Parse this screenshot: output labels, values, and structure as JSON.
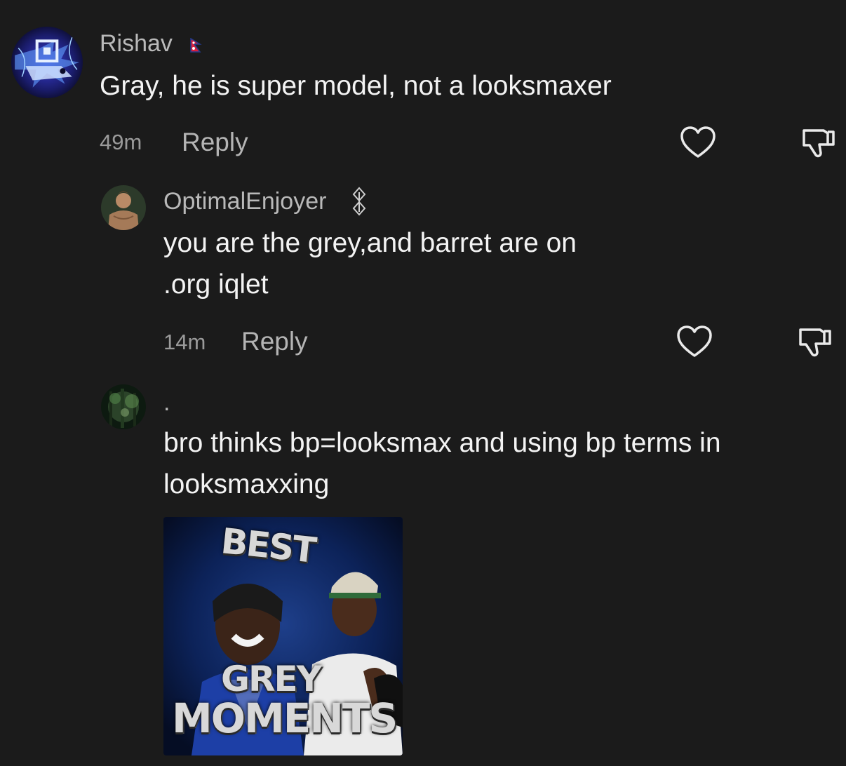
{
  "comments": [
    {
      "username": "Rishav",
      "badge_icon": "nepal-flag-icon",
      "text_lines": [
        "Gray, he is super model, not a looksmaxer"
      ],
      "time": "49m",
      "reply_label": "Reply",
      "avatar_icon": "geometry-dash-avatar"
    },
    {
      "username": "OptimalEnjoyer",
      "badge_icon": "chain-link-icon",
      "text_lines": [
        "you are the grey,and barret are on",
        ".org iqlet"
      ],
      "time": "14m",
      "reply_label": "Reply",
      "avatar_icon": "statue-avatar"
    },
    {
      "username": ".",
      "text_lines": [
        "bro thinks bp=looksmax and using bp terms in",
        "looksmaxxing"
      ],
      "avatar_icon": "forest-avatar",
      "attachment": {
        "line1": "BEST",
        "line2": "GREY",
        "line3": "MOMENTS"
      }
    }
  ],
  "icons": {
    "like": "heart-outline-icon",
    "dislike": "thumbs-down-outline-icon"
  },
  "colors": {
    "background": "#1b1b1b",
    "text": "#f3f3f3",
    "muted": "#9a9a9a"
  }
}
